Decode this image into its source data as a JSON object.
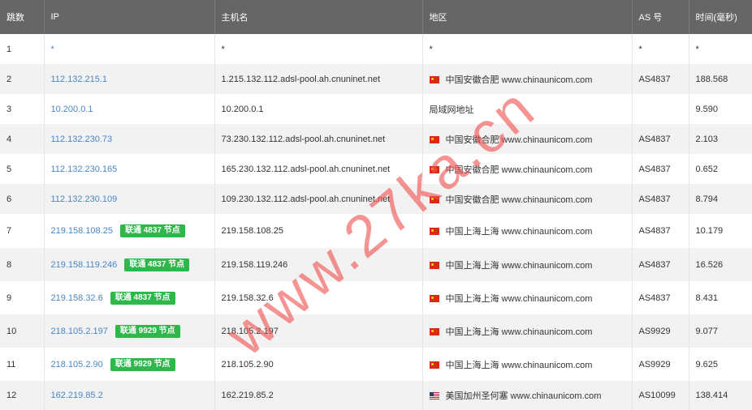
{
  "columns": [
    "跳数",
    "IP",
    "主机名",
    "地区",
    "AS 号",
    "时间(毫秒)"
  ],
  "rows": [
    {
      "hop": "1",
      "ip": "*",
      "badge": "",
      "host": "*",
      "flag": "",
      "region": "*",
      "asn": "*",
      "time": "*"
    },
    {
      "hop": "2",
      "ip": "112.132.215.1",
      "badge": "",
      "host": "1.215.132.112.adsl-pool.ah.cnuninet.net",
      "flag": "cn",
      "region": "中国安徽合肥 www.chinaunicom.com",
      "asn": "AS4837",
      "time": "188.568"
    },
    {
      "hop": "3",
      "ip": "10.200.0.1",
      "badge": "",
      "host": "10.200.0.1",
      "flag": "",
      "region": "局域网地址",
      "asn": "",
      "time": "9.590"
    },
    {
      "hop": "4",
      "ip": "112.132.230.73",
      "badge": "",
      "host": "73.230.132.112.adsl-pool.ah.cnuninet.net",
      "flag": "cn",
      "region": "中国安徽合肥 www.chinaunicom.com",
      "asn": "AS4837",
      "time": "2.103"
    },
    {
      "hop": "5",
      "ip": "112.132.230.165",
      "badge": "",
      "host": "165.230.132.112.adsl-pool.ah.cnuninet.net",
      "flag": "cn",
      "region": "中国安徽合肥 www.chinaunicom.com",
      "asn": "AS4837",
      "time": "0.652"
    },
    {
      "hop": "6",
      "ip": "112.132.230.109",
      "badge": "",
      "host": "109.230.132.112.adsl-pool.ah.cnuninet.net",
      "flag": "cn",
      "region": "中国安徽合肥 www.chinaunicom.com",
      "asn": "AS4837",
      "time": "8.794"
    },
    {
      "hop": "7",
      "ip": "219.158.108.25",
      "badge": "联通 4837 节点",
      "host": "219.158.108.25",
      "flag": "cn",
      "region": "中国上海上海 www.chinaunicom.com",
      "asn": "AS4837",
      "time": "10.179"
    },
    {
      "hop": "8",
      "ip": "219.158.119.246",
      "badge": "联通 4837 节点",
      "host": "219.158.119.246",
      "flag": "cn",
      "region": "中国上海上海 www.chinaunicom.com",
      "asn": "AS4837",
      "time": "16.526"
    },
    {
      "hop": "9",
      "ip": "219.158.32.6",
      "badge": "联通 4837 节点",
      "host": "219.158.32.6",
      "flag": "cn",
      "region": "中国上海上海 www.chinaunicom.com",
      "asn": "AS4837",
      "time": "8.431"
    },
    {
      "hop": "10",
      "ip": "218.105.2.197",
      "badge": "联通 9929 节点",
      "host": "218.105.2.197",
      "flag": "cn",
      "region": "中国上海上海 www.chinaunicom.com",
      "asn": "AS9929",
      "time": "9.077"
    },
    {
      "hop": "11",
      "ip": "218.105.2.90",
      "badge": "联通 9929 节点",
      "host": "218.105.2.90",
      "flag": "cn",
      "region": "中国上海上海 www.chinaunicom.com",
      "asn": "AS9929",
      "time": "9.625"
    },
    {
      "hop": "12",
      "ip": "162.219.85.2",
      "badge": "",
      "host": "162.219.85.2",
      "flag": "us",
      "region": "美国加州圣何塞 www.chinaunicom.com",
      "asn": "AS10099",
      "time": "138.414"
    }
  ],
  "watermark": "www.27ka.cn",
  "colors": {
    "header_bg": "#666666",
    "link": "#4a86c5",
    "badge": "#2eb84b",
    "watermark": "#f05050",
    "stripe": "#f2f2f2"
  }
}
